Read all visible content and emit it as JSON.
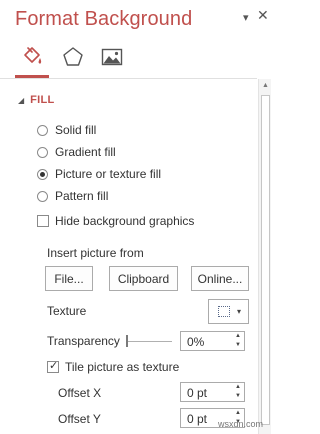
{
  "pane": {
    "title": "Format Background",
    "dropdown_glyph": "▾",
    "close_glyph": "✕",
    "tabs": [
      {
        "name": "fill-bucket-icon",
        "selected": true
      },
      {
        "name": "pentagon-effects-icon",
        "selected": false
      },
      {
        "name": "picture-icon",
        "selected": false
      }
    ],
    "accent_color": "#c0504d"
  },
  "fill": {
    "section_arrow": "◢",
    "section_label": "FILL",
    "options": [
      {
        "label": "Solid fill",
        "checked": false
      },
      {
        "label": "Gradient fill",
        "checked": false
      },
      {
        "label": "Picture or texture fill",
        "checked": true
      },
      {
        "label": "Pattern fill",
        "checked": false
      }
    ],
    "hide_background_graphics": {
      "label": "Hide background graphics",
      "checked": false
    },
    "insert_picture_from": "Insert picture from",
    "buttons": {
      "file": "File...",
      "clipboard": "Clipboard",
      "online": "Online..."
    },
    "texture_label": "Texture",
    "texture_caret": "▾",
    "transparency_label": "Transparency",
    "transparency_value": "0%",
    "transparency_fraction": 0,
    "tile_picture": {
      "label": "Tile picture as texture",
      "checked": true
    },
    "offset_x_label": "Offset X",
    "offset_x_value": "0 pt",
    "offset_y_label": "Offset Y",
    "offset_y_value": "0 pt",
    "spin_up_glyph": "▲",
    "spin_down_glyph": "▼"
  },
  "scrollbar": {
    "up_glyph": "▲"
  },
  "watermark": "wsxdn.com"
}
